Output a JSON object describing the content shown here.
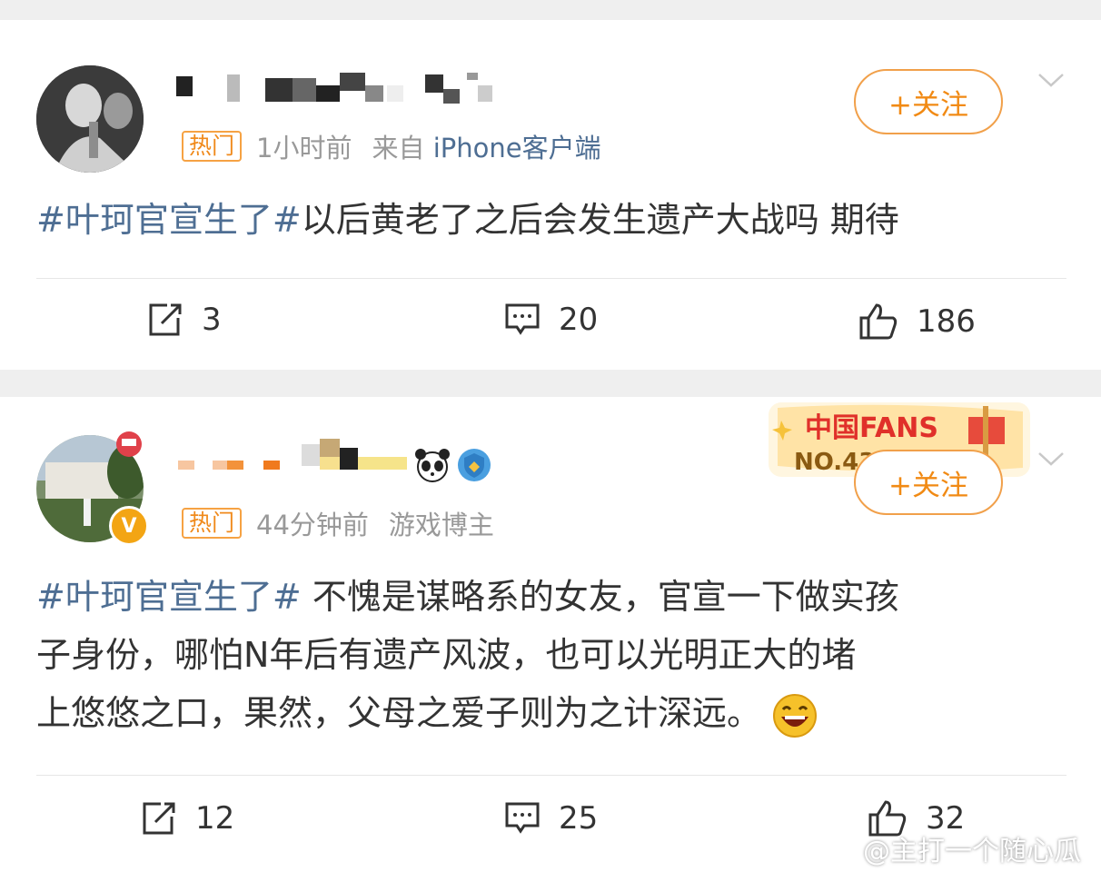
{
  "posts": [
    {
      "hot_label": "热门",
      "time": "1小时前",
      "source_prefix": "来自",
      "source_device": "iPhone客户端",
      "follow_label": "+关注",
      "tag": "#叶珂官宣生了#",
      "text": "以后黄老了之后会发生遗产大战吗 期待",
      "repost_count": "3",
      "comment_count": "20",
      "like_count": "186"
    },
    {
      "hot_label": "热门",
      "time": "44分钟前",
      "source_prefix": "",
      "source_device": "游戏博主",
      "follow_label": "+关注",
      "tag": "#叶珂官宣生了#",
      "text_line1": " 不愧是谋略系的女友，官宣一下做实孩",
      "text_line2": "子身份，哪怕N年后有遗产风波，也可以光明正大的堵",
      "text_line3": "上悠悠之口，果然，父母之爱子则为之计深远。",
      "badge_title": "中国FANS",
      "badge_no": "NO.43",
      "verified": "V",
      "repost_count": "12",
      "comment_count": "25",
      "like_count": "32"
    }
  ],
  "watermark": "@主打一个随心瓜",
  "colors": {
    "accent_orange": "#f18a14",
    "topic_blue": "#4e6e93",
    "meta_gray": "#999999"
  }
}
